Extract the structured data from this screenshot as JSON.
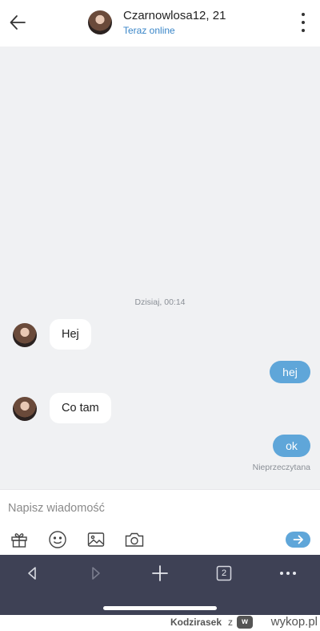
{
  "header": {
    "back_icon": "arrow-left-icon",
    "contact_name": "Czarnowlosa12, 21",
    "status": "Teraz online",
    "status_color": "#3a86c8",
    "menu_icon": "more-vertical-icon"
  },
  "chat": {
    "background": "#f0f1f3",
    "date_separator": "Dzisiaj, 00:14",
    "messages": [
      {
        "direction": "incoming",
        "text": "Hej"
      },
      {
        "direction": "outgoing",
        "text": "hej"
      },
      {
        "direction": "incoming",
        "text": "Co tam"
      },
      {
        "direction": "outgoing",
        "text": "ok"
      }
    ],
    "read_status": "Nieprzeczytana",
    "outgoing_color": "#5fa6d9"
  },
  "composer": {
    "placeholder": "Napisz wiadomość",
    "tools": [
      "gift-icon",
      "emoji-icon",
      "image-icon",
      "camera-icon"
    ],
    "send_icon": "send-arrow-icon"
  },
  "browser_bar": {
    "tabs_count": "2",
    "buttons": [
      "back-icon",
      "forward-icon",
      "new-tab-icon",
      "tabs-icon",
      "more-horizontal-icon"
    ]
  },
  "watermark": {
    "user": "Kodzirasek",
    "separator": "z",
    "logo": "w",
    "site": "wykop.pl"
  }
}
